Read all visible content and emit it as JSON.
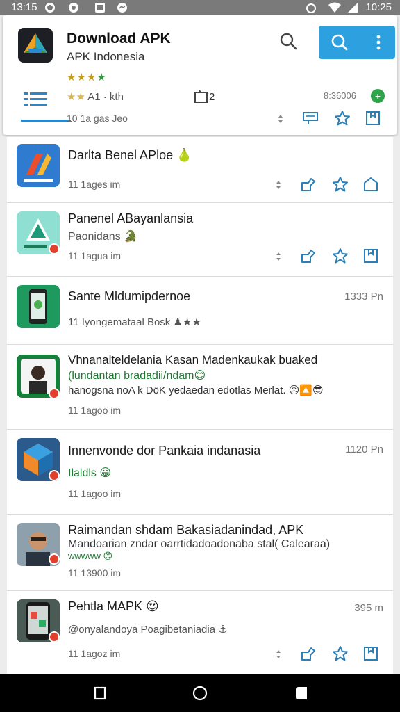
{
  "status_bar": {
    "time_left": "13:15",
    "time_right": "10:25",
    "icons": [
      "whatsapp-icon",
      "settings-circle-icon",
      "image-icon",
      "messenger-icon",
      "alarm-icon",
      "wifi-icon",
      "signal-icon"
    ]
  },
  "header": {
    "title": "Download APK",
    "subtitle": "APK Indonesia",
    "stars": "★★★",
    "stars_green": "★",
    "rating_stars": "★★",
    "rating_text": "A1 · kth",
    "box_count": "2",
    "code": "8:36006",
    "plus_badge": "+",
    "time_text": "10 1a gas Jeo",
    "accent": "#2da0df"
  },
  "items": [
    {
      "name": "Darlta Benel APloe 🍐",
      "sub": "",
      "meta": "11 1ages im",
      "right": "",
      "thumb_bg": "#2a6fbf"
    },
    {
      "name": "Panenel ABayanlansia",
      "sub": "Paonidans 🐊",
      "meta": "11 1agua im",
      "right": "",
      "thumb_bg": "#7fd4c7"
    },
    {
      "name": "Sante Mldumipdernoe",
      "sub": "11 Iyongemataal Bosk ♟★★",
      "meta": "",
      "right": "1333 Pn",
      "thumb_bg": "#1f8f5a"
    },
    {
      "name": "Vhnanalteldelania Kasan Madenkaukak buaked",
      "sub": "(lundantan bradadii/ndam😊",
      "sub2": "hanogsna noA k DöK yedaedan edotlas Merlat. 😥🔼😎",
      "meta": "11 1agoo im",
      "right": "",
      "thumb_bg": "#1a7a3c"
    },
    {
      "name": "Innenvonde dor Pankaia indanasia",
      "sub": "Ilaldls 😀",
      "meta": "11 1agoo im",
      "right": "1120 Pn",
      "thumb_bg": "#2a5b8c"
    },
    {
      "name": "Raimandan shdam Bakasiadanindad, APK",
      "sub": "Mandoarian zndar oarrtidadoadonaba stal( Calearaa)",
      "sub2": "wwwww 😊",
      "meta": "11 13900 im",
      "right": "",
      "thumb_bg": "#7a8b98"
    },
    {
      "name": "Pehtla MAPK 😍",
      "sub": "@onyalandoya Poagibetaniadia ⚓",
      "meta": "11 1agoz im",
      "right": "395 m",
      "thumb_bg": "#3a4a44"
    }
  ]
}
